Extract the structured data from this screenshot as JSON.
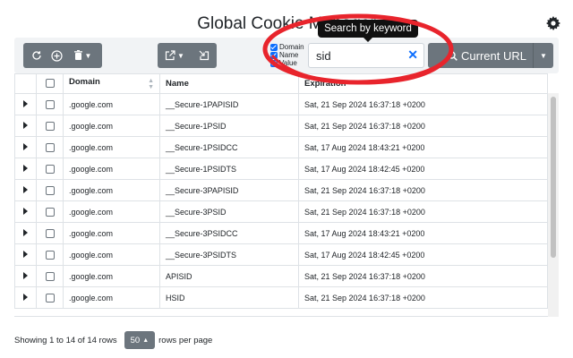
{
  "app": {
    "title": "Global Cookie Manager"
  },
  "filters": {
    "labels": [
      "Domain",
      "Name",
      "Value"
    ]
  },
  "search": {
    "value": "sid",
    "tooltip": "Search by keyword"
  },
  "url_button": {
    "label": "Current URL"
  },
  "table": {
    "headers": [
      "Domain",
      "Name",
      "Expiration"
    ],
    "rows": [
      {
        "domain": ".google.com",
        "name": "__Secure-1PAPISID",
        "expiration": "Sat, 21 Sep 2024 16:37:18 +0200"
      },
      {
        "domain": ".google.com",
        "name": "__Secure-1PSID",
        "expiration": "Sat, 21 Sep 2024 16:37:18 +0200"
      },
      {
        "domain": ".google.com",
        "name": "__Secure-1PSIDCC",
        "expiration": "Sat, 17 Aug 2024 18:43:21 +0200"
      },
      {
        "domain": ".google.com",
        "name": "__Secure-1PSIDTS",
        "expiration": "Sat, 17 Aug 2024 18:42:45 +0200"
      },
      {
        "domain": ".google.com",
        "name": "__Secure-3PAPISID",
        "expiration": "Sat, 21 Sep 2024 16:37:18 +0200"
      },
      {
        "domain": ".google.com",
        "name": "__Secure-3PSID",
        "expiration": "Sat, 21 Sep 2024 16:37:18 +0200"
      },
      {
        "domain": ".google.com",
        "name": "__Secure-3PSIDCC",
        "expiration": "Sat, 17 Aug 2024 18:43:21 +0200"
      },
      {
        "domain": ".google.com",
        "name": "__Secure-3PSIDTS",
        "expiration": "Sat, 17 Aug 2024 18:42:45 +0200"
      },
      {
        "domain": ".google.com",
        "name": "APISID",
        "expiration": "Sat, 21 Sep 2024 16:37:18 +0200"
      },
      {
        "domain": ".google.com",
        "name": "HSID",
        "expiration": "Sat, 21 Sep 2024 16:37:18 +0200"
      }
    ]
  },
  "footer": {
    "showing": "Showing 1 to 14 of 14 rows",
    "per_page": "50",
    "per_page_suffix": "rows per page"
  },
  "colors": {
    "accent": "#0d6efd",
    "button": "#6c757d",
    "highlight_circle": "#e8242c"
  }
}
